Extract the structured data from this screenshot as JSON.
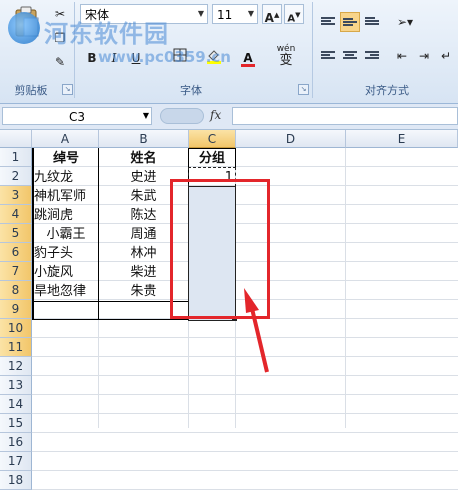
{
  "watermark": {
    "site": "河东软件园",
    "url": "www.pc0359.cn"
  },
  "ribbon": {
    "clipboard": {
      "label": "剪贴板"
    },
    "font": {
      "label": "字体",
      "family": "宋体",
      "size": "11",
      "grow_label": "A",
      "shrink_label": "A",
      "bold_label": "B",
      "italic_label": "I",
      "underline_label": "U",
      "font_color_label": "A",
      "phonetic_label": "wén",
      "phonetic_glyph": "变"
    },
    "alignment": {
      "label": "对齐方式"
    }
  },
  "formula_bar": {
    "name_box": "C3",
    "fx_label": "fx",
    "formula": ""
  },
  "grid": {
    "columns": [
      "A",
      "B",
      "C",
      "D",
      "E"
    ],
    "selected_column": "C",
    "rows": [
      "1",
      "2",
      "3",
      "4",
      "5",
      "6",
      "7",
      "8",
      "9",
      "10",
      "11",
      "12",
      "13",
      "14",
      "15",
      "16",
      "17",
      "18"
    ],
    "selected_rows": [
      "3",
      "4",
      "5",
      "6",
      "7",
      "8",
      "9",
      "10",
      "11"
    ],
    "headers": {
      "a": "绰号",
      "b": "姓名",
      "c": "分组"
    },
    "data": [
      {
        "a": "九纹龙",
        "b": "史进",
        "c": "1"
      },
      {
        "a": "神机军师",
        "b": "朱武",
        "c": ""
      },
      {
        "a": "跳涧虎",
        "b": "陈达",
        "c": ""
      },
      {
        "a": "小霸王",
        "b": "周通",
        "c": ""
      },
      {
        "a": "豹子头",
        "b": "林冲",
        "c": ""
      },
      {
        "a": "小旋风",
        "b": "柴进",
        "c": ""
      },
      {
        "a": "旱地忽律",
        "b": "朱贵",
        "c": ""
      }
    ]
  },
  "colors": {
    "highlight": "#e3262b",
    "selection": "#dde6f2",
    "header_selected": "#f2c66a"
  }
}
